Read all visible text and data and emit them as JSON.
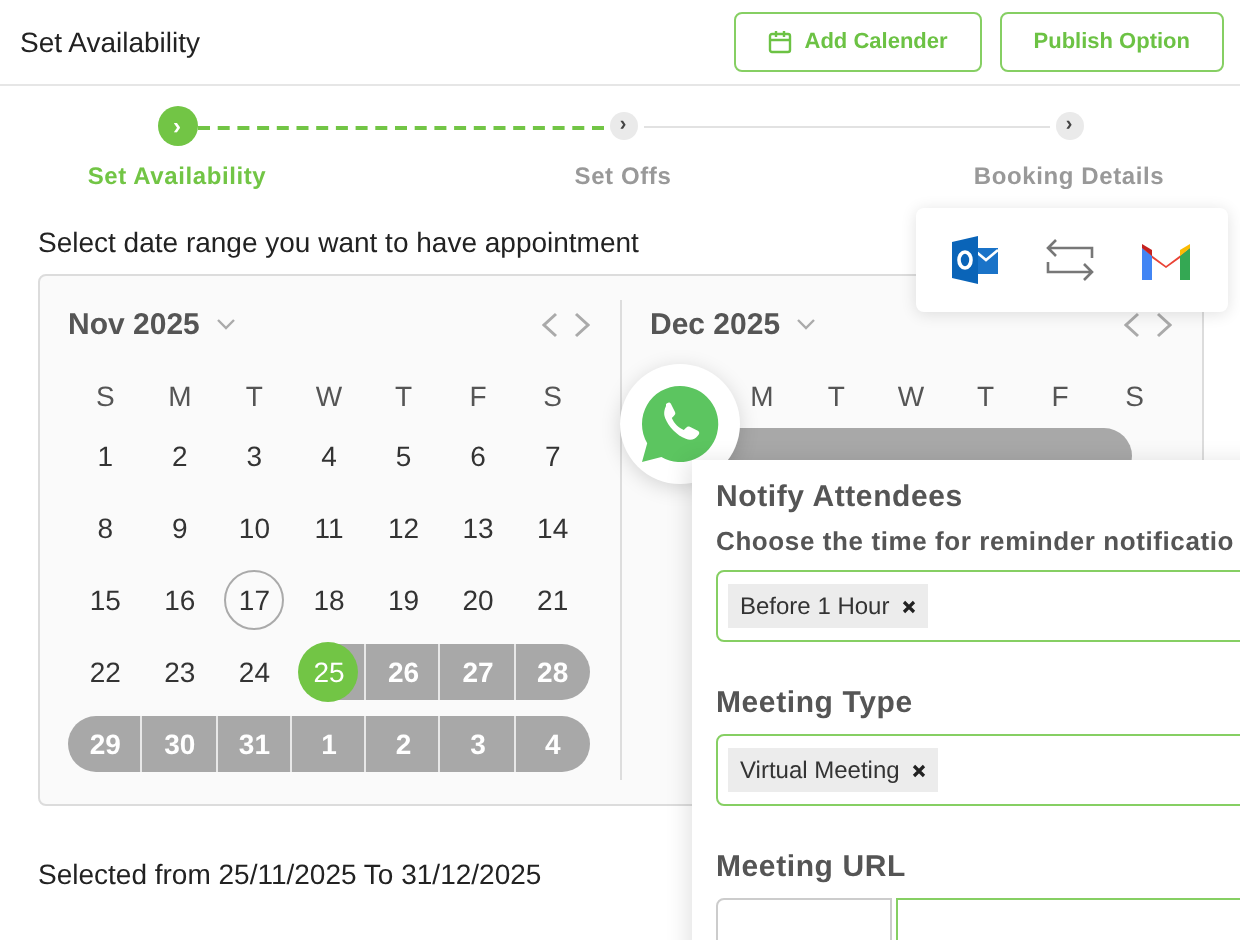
{
  "header": {
    "title": "Set Availability",
    "buttons": [
      {
        "label": "Add Calender",
        "kind": "calendar"
      },
      {
        "label": "Publish Option",
        "kind": "plain"
      }
    ]
  },
  "steps": [
    {
      "label": "Set Availability",
      "icon": "›",
      "active": true
    },
    {
      "label": "Set Offs",
      "icon": "›",
      "active": false
    },
    {
      "label": "Booking Details",
      "icon": "›",
      "active": false
    }
  ],
  "prompt": "Select date range you want to have appointment",
  "november": {
    "title": "Nov 2025",
    "weekdays": [
      "S",
      "M",
      "T",
      "W",
      "T",
      "F",
      "S"
    ],
    "weeks": [
      [
        {
          "day": "1",
          "today": false,
          "selected": false,
          "in_range": false
        },
        {
          "day": "2",
          "today": false,
          "selected": false,
          "in_range": false
        },
        {
          "day": "3",
          "today": false,
          "selected": false,
          "in_range": false
        },
        {
          "day": "4",
          "today": false,
          "selected": false,
          "in_range": false
        },
        {
          "day": "5",
          "today": false,
          "selected": false,
          "in_range": false
        },
        {
          "day": "6",
          "today": false,
          "selected": false,
          "in_range": false
        },
        {
          "day": "7",
          "today": false,
          "selected": false,
          "in_range": false
        }
      ],
      [
        {
          "day": "8",
          "today": false,
          "selected": false,
          "in_range": false
        },
        {
          "day": "9",
          "today": false,
          "selected": false,
          "in_range": false
        },
        {
          "day": "10",
          "today": false,
          "selected": false,
          "in_range": false
        },
        {
          "day": "11",
          "today": false,
          "selected": false,
          "in_range": false
        },
        {
          "day": "12",
          "today": false,
          "selected": false,
          "in_range": false
        },
        {
          "day": "13",
          "today": false,
          "selected": false,
          "in_range": false
        },
        {
          "day": "14",
          "today": false,
          "selected": false,
          "in_range": false
        }
      ],
      [
        {
          "day": "15",
          "today": false,
          "selected": false,
          "in_range": false
        },
        {
          "day": "16",
          "today": false,
          "selected": false,
          "in_range": false
        },
        {
          "day": "17",
          "today": true,
          "selected": false,
          "in_range": false
        },
        {
          "day": "18",
          "today": false,
          "selected": false,
          "in_range": false
        },
        {
          "day": "19",
          "today": false,
          "selected": false,
          "in_range": false
        },
        {
          "day": "20",
          "today": false,
          "selected": false,
          "in_range": false
        },
        {
          "day": "21",
          "today": false,
          "selected": false,
          "in_range": false
        }
      ],
      [
        {
          "day": "22",
          "today": false,
          "selected": false,
          "in_range": false
        },
        {
          "day": "23",
          "today": false,
          "selected": false,
          "in_range": false
        },
        {
          "day": "24",
          "today": false,
          "selected": false,
          "in_range": false
        },
        {
          "day": "25",
          "today": false,
          "selected": true,
          "in_range": true
        },
        {
          "day": "26",
          "today": false,
          "selected": false,
          "in_range": true
        },
        {
          "day": "27",
          "today": false,
          "selected": false,
          "in_range": true
        },
        {
          "day": "28",
          "today": false,
          "selected": false,
          "in_range": true
        }
      ],
      [
        {
          "day": "29",
          "today": false,
          "selected": false,
          "in_range": true
        },
        {
          "day": "30",
          "today": false,
          "selected": false,
          "in_range": true
        },
        {
          "day": "31",
          "today": false,
          "selected": false,
          "in_range": true
        },
        {
          "day": "1",
          "today": false,
          "selected": false,
          "in_range": true
        },
        {
          "day": "2",
          "today": false,
          "selected": false,
          "in_range": true
        },
        {
          "day": "3",
          "today": false,
          "selected": false,
          "in_range": true
        },
        {
          "day": "4",
          "today": false,
          "selected": false,
          "in_range": true
        }
      ]
    ]
  },
  "december": {
    "title": "Dec 2025",
    "weekdays": [
      "M",
      "T",
      "W",
      "T",
      "F",
      "S"
    ]
  },
  "summary": "Selected from 25/11/2025 To 31/12/2025",
  "panel": {
    "sections": [
      {
        "title": "Notify Attendees",
        "hint": "Choose the time for reminder notificatio",
        "chips": [
          "Before 1 Hour"
        ]
      },
      {
        "title": "Meeting Type",
        "chips": [
          "Virtual Meeting"
        ]
      },
      {
        "title": "Meeting URL"
      }
    ]
  }
}
